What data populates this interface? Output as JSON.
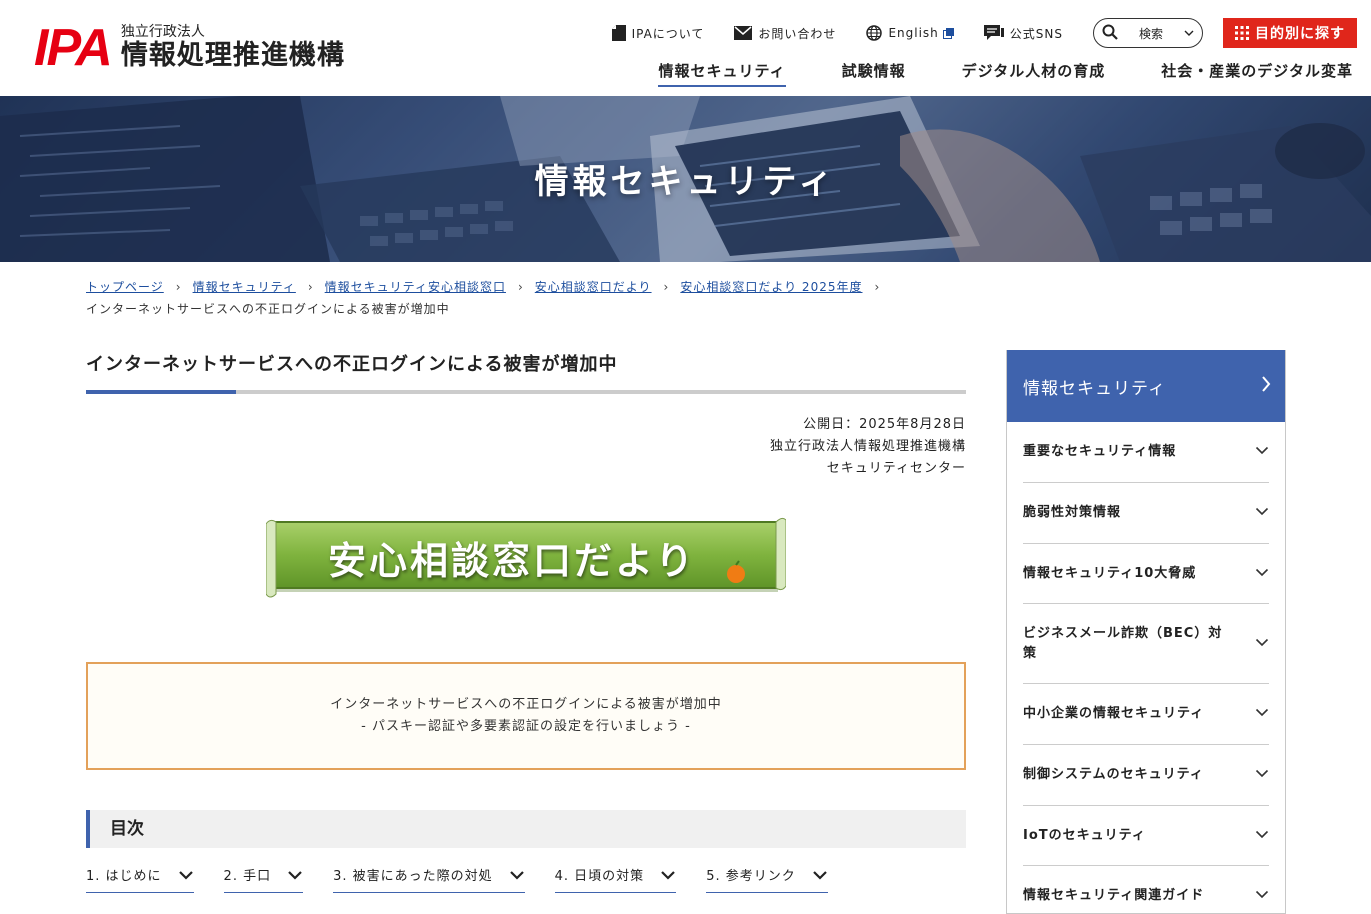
{
  "header": {
    "logo_mark": "IPA",
    "logo_sub": "独立行政法人",
    "logo_main": "情報処理推進機構",
    "utility": [
      {
        "label": "IPAについて",
        "icon": "document-icon"
      },
      {
        "label": "お問い合わせ",
        "icon": "mail-icon"
      },
      {
        "label": "English",
        "icon": "globe-icon"
      },
      {
        "label": "公式SNS",
        "icon": "chat-icon"
      }
    ],
    "search_label": "検索",
    "purpose_label": "目的別に探す",
    "nav": [
      "情報セキュリティ",
      "試験情報",
      "デジタル人材の育成",
      "社会・産業のデジタル変革"
    ]
  },
  "hero": {
    "title": "情報セキュリティ"
  },
  "breadcrumb": {
    "items": [
      "トップページ",
      "情報セキュリティ",
      "情報セキュリティ安心相談窓口",
      "安心相談窓口だより",
      "安心相談窓口だより 2025年度"
    ],
    "current": "インターネットサービスへの不正ログインによる被害が増加中"
  },
  "article": {
    "title": "インターネットサービスへの不正ログインによる被害が増加中",
    "published": "公開日：2025年8月28日",
    "org": "独立行政法人情報処理推進機構",
    "dept": "セキュリティセンター",
    "banner": "安心相談窓口だより",
    "notice_line1": "インターネットサービスへの不正ログインによる被害が増加中",
    "notice_line2": "- パスキー認証や多要素認証の設定を行いましょう -",
    "toc_title": "目次",
    "toc": [
      "1. はじめに",
      "2. 手口",
      "3. 被害にあった際の対処",
      "4. 日頃の対策",
      "5. 参考リンク"
    ]
  },
  "sidebar": {
    "title": "情報セキュリティ",
    "items": [
      "重要なセキュリティ情報",
      "脆弱性対策情報",
      "情報セキュリティ10大脅威",
      "ビジネスメール詐欺（BEC）対策",
      "中小企業の情報セキュリティ",
      "制御システムのセキュリティ",
      "IoTのセキュリティ",
      "情報セキュリティ関連ガイド"
    ]
  },
  "colors": {
    "brand_red": "#e60012",
    "accent_blue": "#3f63ad",
    "notice_border": "#e3a15a"
  }
}
